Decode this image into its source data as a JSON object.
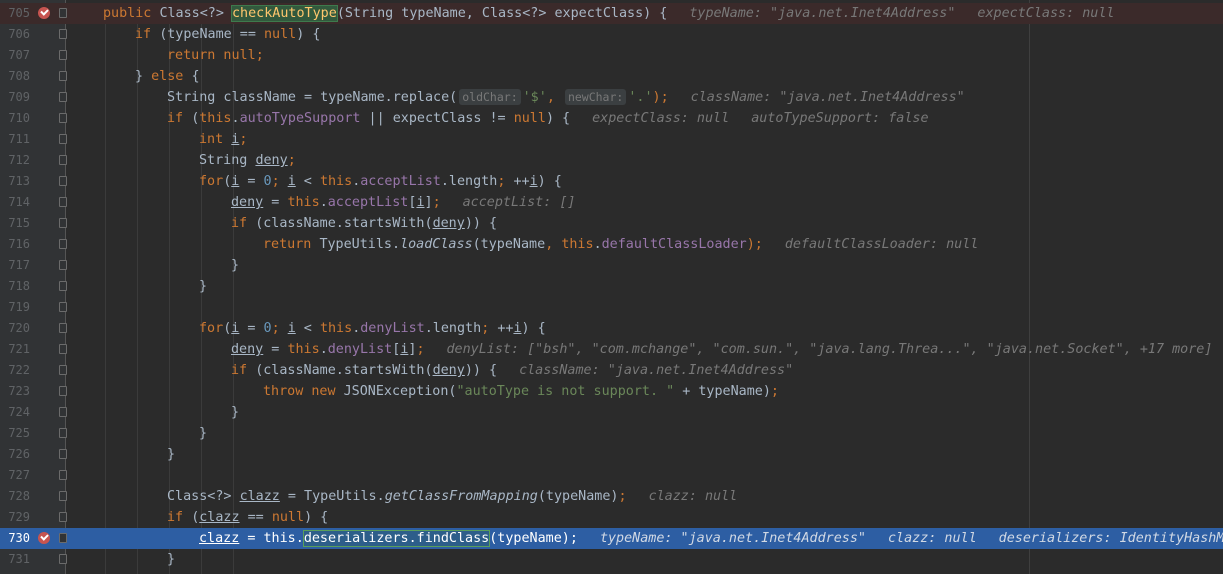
{
  "editor": {
    "lines": [
      {
        "num": "705",
        "breakpoint": true,
        "indent": 0,
        "tokens": [
          {
            "t": "public ",
            "c": "kw"
          },
          {
            "t": "Class<?> "
          },
          {
            "t": "checkAutoType",
            "c": "hl-method"
          },
          {
            "t": "(String typeName, Class<?> expectClass) {"
          },
          {
            "gap": 1
          },
          {
            "t": "typeName: \"java.net.Inet4Address\"",
            "c": "hint"
          },
          {
            "gap": 1
          },
          {
            "t": "expectClass: null",
            "c": "hint"
          }
        ]
      },
      {
        "num": "706",
        "indent": 1,
        "tokens": [
          {
            "t": "if ",
            "c": "kw"
          },
          {
            "t": "(typeName == "
          },
          {
            "t": "null",
            "c": "kw"
          },
          {
            "t": ") {"
          }
        ]
      },
      {
        "num": "707",
        "indent": 2,
        "tokens": [
          {
            "t": "return null",
            "c": "kw"
          },
          {
            "t": ";",
            "c": "kw"
          }
        ]
      },
      {
        "num": "708",
        "indent": 1,
        "tokens": [
          {
            "t": "} "
          },
          {
            "t": "else ",
            "c": "kw"
          },
          {
            "t": "{"
          }
        ]
      },
      {
        "num": "709",
        "indent": 2,
        "tokens": [
          {
            "t": "String className = typeName.replace("
          },
          {
            "ph": "oldChar:"
          },
          {
            "t": "'$'",
            "c": "str"
          },
          {
            "t": ", ",
            "c": "kw"
          },
          {
            "ph": "newChar:"
          },
          {
            "t": "'.'",
            "c": "str"
          },
          {
            "t": ");",
            "c": "kw"
          },
          {
            "gap": 1
          },
          {
            "t": "className: \"java.net.Inet4Address\"",
            "c": "hint"
          }
        ]
      },
      {
        "num": "710",
        "indent": 2,
        "tokens": [
          {
            "t": "if ",
            "c": "kw"
          },
          {
            "t": "("
          },
          {
            "t": "this",
            "c": "kw"
          },
          {
            "t": "."
          },
          {
            "t": "autoTypeSupport",
            "c": "fld"
          },
          {
            "t": " || expectClass != "
          },
          {
            "t": "null",
            "c": "kw"
          },
          {
            "t": ") {"
          },
          {
            "gap": 1
          },
          {
            "t": "expectClass: null",
            "c": "hint"
          },
          {
            "gap": 1
          },
          {
            "t": "autoTypeSupport: false",
            "c": "hint"
          }
        ]
      },
      {
        "num": "711",
        "indent": 3,
        "tokens": [
          {
            "t": "int ",
            "c": "kw"
          },
          {
            "t": "i",
            "c": "ul"
          },
          {
            "t": ";",
            "c": "kw"
          }
        ]
      },
      {
        "num": "712",
        "indent": 3,
        "tokens": [
          {
            "t": "String "
          },
          {
            "t": "deny",
            "c": "ul"
          },
          {
            "t": ";",
            "c": "kw"
          }
        ]
      },
      {
        "num": "713",
        "indent": 3,
        "tokens": [
          {
            "t": "for",
            "c": "kw"
          },
          {
            "t": "("
          },
          {
            "t": "i",
            "c": "ul"
          },
          {
            "t": " = "
          },
          {
            "t": "0",
            "c": "num"
          },
          {
            "t": "; ",
            "c": "kw"
          },
          {
            "t": "i",
            "c": "ul"
          },
          {
            "t": " < "
          },
          {
            "t": "this",
            "c": "kw"
          },
          {
            "t": "."
          },
          {
            "t": "acceptList",
            "c": "fld"
          },
          {
            "t": ".length"
          },
          {
            "t": "; ",
            "c": "kw"
          },
          {
            "t": "++"
          },
          {
            "t": "i",
            "c": "ul"
          },
          {
            "t": ") {"
          }
        ]
      },
      {
        "num": "714",
        "indent": 4,
        "tokens": [
          {
            "t": "deny",
            "c": "ul"
          },
          {
            "t": " = "
          },
          {
            "t": "this",
            "c": "kw"
          },
          {
            "t": "."
          },
          {
            "t": "acceptList",
            "c": "fld"
          },
          {
            "t": "["
          },
          {
            "t": "i",
            "c": "ul"
          },
          {
            "t": "]"
          },
          {
            "t": ";",
            "c": "kw"
          },
          {
            "gap": 1
          },
          {
            "t": "acceptList: []",
            "c": "hint"
          }
        ]
      },
      {
        "num": "715",
        "indent": 4,
        "tokens": [
          {
            "t": "if ",
            "c": "kw"
          },
          {
            "t": "(className.startsWith("
          },
          {
            "t": "deny",
            "c": "ul"
          },
          {
            "t": ")) {"
          }
        ]
      },
      {
        "num": "716",
        "indent": 5,
        "tokens": [
          {
            "t": "return ",
            "c": "kw"
          },
          {
            "t": "TypeUtils."
          },
          {
            "t": "loadClass",
            "c": "it"
          },
          {
            "t": "(typeName"
          },
          {
            "t": ", ",
            "c": "kw"
          },
          {
            "t": "this",
            "c": "kw"
          },
          {
            "t": "."
          },
          {
            "t": "defaultClassLoader",
            "c": "fld"
          },
          {
            "t": ");",
            "c": "kw"
          },
          {
            "gap": 1
          },
          {
            "t": "defaultClassLoader: null",
            "c": "hint"
          }
        ]
      },
      {
        "num": "717",
        "indent": 4,
        "tokens": [
          {
            "t": "}"
          }
        ]
      },
      {
        "num": "718",
        "indent": 3,
        "tokens": [
          {
            "t": "}"
          }
        ]
      },
      {
        "num": "719",
        "indent": 0,
        "tokens": []
      },
      {
        "num": "720",
        "indent": 3,
        "tokens": [
          {
            "t": "for",
            "c": "kw"
          },
          {
            "t": "("
          },
          {
            "t": "i",
            "c": "ul"
          },
          {
            "t": " = "
          },
          {
            "t": "0",
            "c": "num"
          },
          {
            "t": "; ",
            "c": "kw"
          },
          {
            "t": "i",
            "c": "ul"
          },
          {
            "t": " < "
          },
          {
            "t": "this",
            "c": "kw"
          },
          {
            "t": "."
          },
          {
            "t": "denyList",
            "c": "fld"
          },
          {
            "t": ".length"
          },
          {
            "t": "; ",
            "c": "kw"
          },
          {
            "t": "++"
          },
          {
            "t": "i",
            "c": "ul"
          },
          {
            "t": ") {"
          }
        ]
      },
      {
        "num": "721",
        "indent": 4,
        "tokens": [
          {
            "t": "deny",
            "c": "ul"
          },
          {
            "t": " = "
          },
          {
            "t": "this",
            "c": "kw"
          },
          {
            "t": "."
          },
          {
            "t": "denyList",
            "c": "fld"
          },
          {
            "t": "["
          },
          {
            "t": "i",
            "c": "ul"
          },
          {
            "t": "]"
          },
          {
            "t": ";",
            "c": "kw"
          },
          {
            "gap": 1
          },
          {
            "t": "denyList: [\"bsh\", \"com.mchange\", \"com.sun.\", \"java.lang.Threa...\", \"java.net.Socket\", +17 more]",
            "c": "hint"
          }
        ]
      },
      {
        "num": "722",
        "indent": 4,
        "tokens": [
          {
            "t": "if ",
            "c": "kw"
          },
          {
            "t": "(className.startsWith("
          },
          {
            "t": "deny",
            "c": "ul"
          },
          {
            "t": ")) {"
          },
          {
            "gap": 1
          },
          {
            "t": "className: \"java.net.Inet4Address\"",
            "c": "hint"
          }
        ]
      },
      {
        "num": "723",
        "indent": 5,
        "tokens": [
          {
            "t": "throw new ",
            "c": "kw"
          },
          {
            "t": "JSONException("
          },
          {
            "t": "\"autoType is not support. \"",
            "c": "str"
          },
          {
            "t": " + typeName)"
          },
          {
            "t": ";",
            "c": "kw"
          }
        ]
      },
      {
        "num": "724",
        "indent": 4,
        "tokens": [
          {
            "t": "}"
          }
        ]
      },
      {
        "num": "725",
        "indent": 3,
        "tokens": [
          {
            "t": "}"
          }
        ]
      },
      {
        "num": "726",
        "indent": 2,
        "tokens": [
          {
            "t": "}"
          }
        ]
      },
      {
        "num": "727",
        "indent": 0,
        "tokens": []
      },
      {
        "num": "728",
        "indent": 2,
        "tokens": [
          {
            "t": "Class<?> "
          },
          {
            "t": "clazz",
            "c": "ul"
          },
          {
            "t": " = TypeUtils."
          },
          {
            "t": "getClassFromMapping",
            "c": "it"
          },
          {
            "t": "(typeName)"
          },
          {
            "t": ";",
            "c": "kw"
          },
          {
            "gap": 1
          },
          {
            "t": "clazz: null",
            "c": "hint"
          }
        ]
      },
      {
        "num": "729",
        "indent": 2,
        "tokens": [
          {
            "t": "if ",
            "c": "kw"
          },
          {
            "t": "("
          },
          {
            "t": "clazz",
            "c": "ul"
          },
          {
            "t": " == "
          },
          {
            "t": "null",
            "c": "kw"
          },
          {
            "t": ") {"
          }
        ]
      },
      {
        "num": "730",
        "indent": 3,
        "exec": true,
        "breakpoint": true,
        "tokens": [
          {
            "t": "clazz",
            "c": "ul"
          },
          {
            "t": " = "
          },
          {
            "t": "this",
            "c": "kw"
          },
          {
            "t": "."
          },
          {
            "t": "deserializers.findClass",
            "c": "hl-box"
          },
          {
            "t": "(typeName)"
          },
          {
            "t": ";",
            "c": "kw"
          },
          {
            "gap": 1
          },
          {
            "t": "typeName: \"java.net.Inet4Address\"",
            "c": "hint"
          },
          {
            "gap": 1
          },
          {
            "t": "clazz: null",
            "c": "hint"
          },
          {
            "gap": 1
          },
          {
            "t": "deserializers: IdentityHashMap",
            "c": "hint"
          }
        ]
      },
      {
        "num": "731",
        "indent": 2,
        "tokens": [
          {
            "t": "}"
          }
        ]
      }
    ]
  }
}
